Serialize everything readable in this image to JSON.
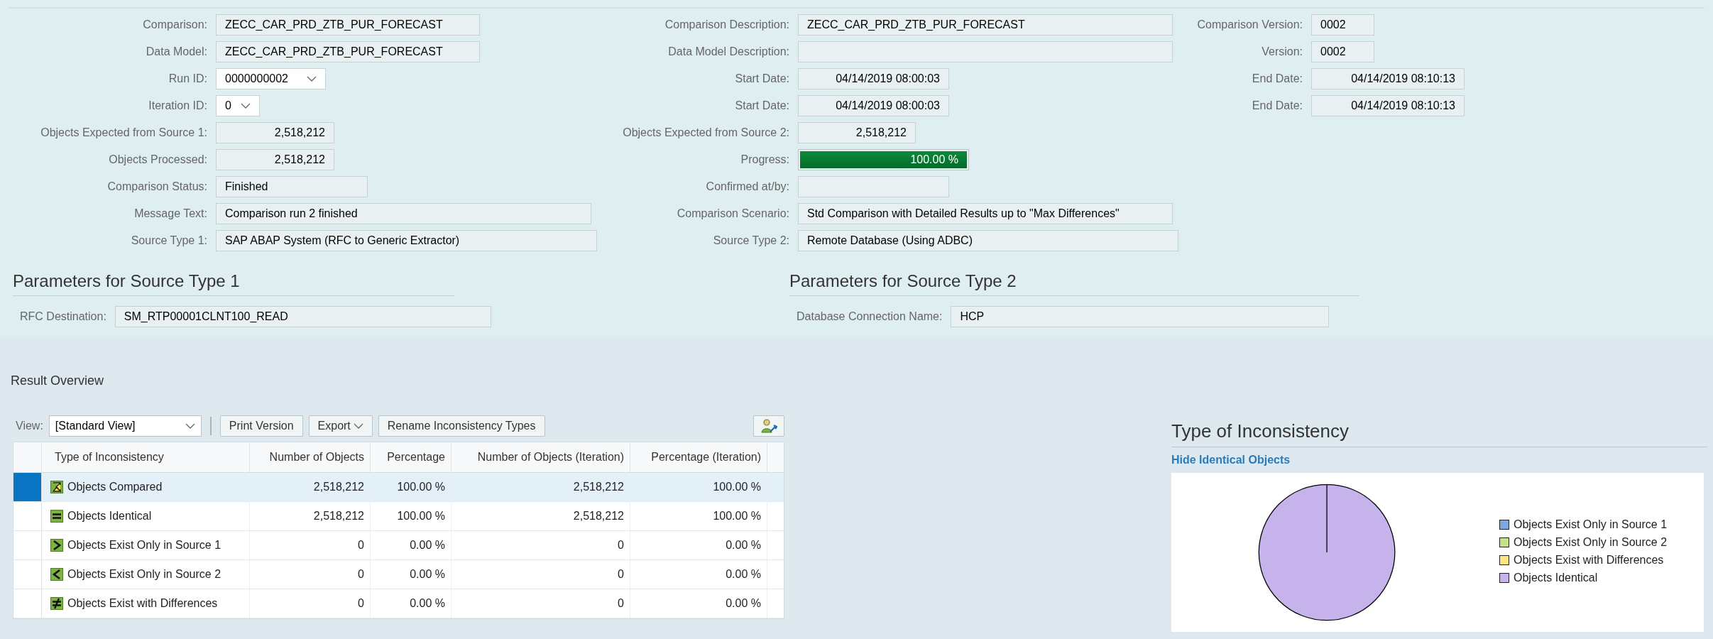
{
  "header": {
    "left": [
      {
        "label": "Comparison:",
        "value": "ZECC_CAR_PRD_ZTB_PUR_FORECAST",
        "kind": "text"
      },
      {
        "label": "Data Model:",
        "value": "ZECC_CAR_PRD_ZTB_PUR_FORECAST",
        "kind": "text"
      },
      {
        "label": "Run ID:",
        "value": "0000000002",
        "kind": "dropdown"
      },
      {
        "label": "Iteration ID:",
        "value": "0",
        "kind": "dropdown"
      },
      {
        "label": "Objects Expected from Source 1:",
        "value": "2,518,212",
        "kind": "number"
      },
      {
        "label": "Objects Processed:",
        "value": "2,518,212",
        "kind": "number"
      },
      {
        "label": "Comparison Status:",
        "value": "Finished",
        "kind": "text"
      },
      {
        "label": "Message Text:",
        "value": "Comparison run 2 finished",
        "kind": "text"
      },
      {
        "label": "Source Type 1:",
        "value": "SAP ABAP System (RFC to Generic Extractor)",
        "kind": "text"
      }
    ],
    "middle": [
      {
        "label": "Comparison Description:",
        "value": "ZECC_CAR_PRD_ZTB_PUR_FORECAST",
        "kind": "text"
      },
      {
        "label": "Data Model Description:",
        "kind": "text"
      },
      {
        "label": "Start Date:",
        "value": "04/14/2019 08:00:03",
        "kind": "number"
      },
      {
        "label": "Start Date:",
        "value": "04/14/2019 08:00:03",
        "kind": "number"
      },
      {
        "label": "Objects Expected from Source 2:",
        "value": "2,518,212",
        "kind": "number"
      },
      {
        "label": "Progress:",
        "reading": "100.00 %",
        "level": 1,
        "kind": "progress"
      },
      {
        "label": "Confirmed at/by:",
        "kind": "text"
      },
      {
        "label": "Comparison Scenario:",
        "value": "Std Comparison with Detailed Results up to \"Max Differences\"",
        "kind": "text"
      },
      {
        "label": "Source Type 2:",
        "value": "Remote Database (Using ADBC)",
        "kind": "text"
      }
    ],
    "right": [
      {
        "label": "Comparison Version:",
        "value": "0002",
        "kind": "text"
      },
      {
        "label": "Version:",
        "value": "0002",
        "kind": "text"
      },
      {
        "label": "End Date:",
        "value": "04/14/2019 08:10:13",
        "kind": "number"
      },
      {
        "label": "End Date:",
        "value": "04/14/2019 08:10:13",
        "kind": "number"
      }
    ]
  },
  "parameters": [
    {
      "title": "Parameters for Source Type 1",
      "label": "RFC Destination:",
      "value": "SM_RTP00001CLNT100_READ"
    },
    {
      "title": "Parameters for Source Type 2",
      "label": "Database Connection Name:",
      "value": "HCP"
    }
  ],
  "result_overview": {
    "title": "Result Overview",
    "toolbar": {
      "view_label": "View:",
      "view_value": "[Standard View]",
      "buttons": [
        "Print Version",
        "Export",
        "Rename Inconsistency Types"
      ]
    },
    "table": {
      "columns": [
        "Type of Inconsistency",
        "Number of Objects",
        "Percentage",
        "Number of Objects (Iteration)",
        "Percentage (Iteration)"
      ],
      "rows": [
        {
          "kind": "compared",
          "selected": true,
          "cells": [
            "Objects Compared",
            "2,518,212",
            "100.00 %",
            "2,518,212",
            "100.00 %"
          ]
        },
        {
          "kind": "identical",
          "selected": false,
          "cells": [
            "Objects Identical",
            "2,518,212",
            "100.00 %",
            "2,518,212",
            "100.00 %"
          ]
        },
        {
          "kind": "only1",
          "selected": false,
          "cells": [
            "Objects Exist Only in Source 1",
            "0",
            "0.00 %",
            "0",
            "0.00 %"
          ]
        },
        {
          "kind": "only2",
          "selected": false,
          "cells": [
            "Objects Exist Only in Source 2",
            "0",
            "0.00 %",
            "0",
            "0.00 %"
          ]
        },
        {
          "kind": "different",
          "selected": false,
          "cells": [
            "Objects Exist with Differences",
            "0",
            "0.00 %",
            "0",
            "0.00 %"
          ]
        }
      ]
    }
  },
  "chart": {
    "title": "Type of Inconsistency",
    "link": "Hide Identical Objects",
    "chart_data": {
      "type": "pie",
      "categories": [
        "Objects Exist Only in Source 1",
        "Objects Exist Only in Source 2",
        "Objects Exist with Differences",
        "Objects Identical"
      ],
      "values": [
        0,
        0,
        0,
        100
      ],
      "colors": [
        "#7ea6e0",
        "#c5e08a",
        "#ffe680",
        "#c6b3ec"
      ]
    }
  }
}
